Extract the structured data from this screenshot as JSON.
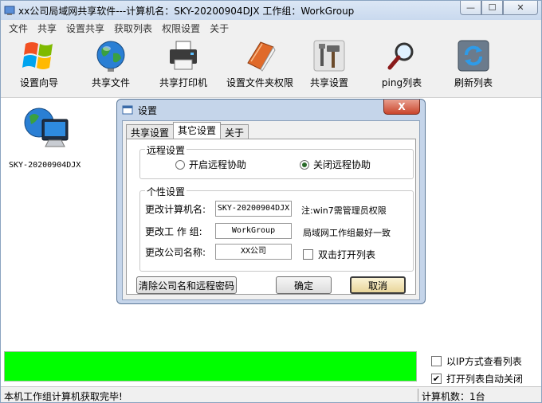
{
  "window": {
    "title": "xx公司局域网共享软件---计算机名：SKY-20200904DJX 工作组：WorkGroup",
    "minimize_glyph": "—",
    "maximize_glyph": "☐",
    "close_glyph": "✕"
  },
  "menu": [
    "文件",
    "共享",
    "设置共享",
    "获取列表",
    "权限设置",
    "关于"
  ],
  "toolbar": [
    {
      "label": "设置向导",
      "icon": "windows-logo-icon"
    },
    {
      "label": "共享文件",
      "icon": "globe-icon"
    },
    {
      "label": "共享打印机",
      "icon": "printer-icon"
    },
    {
      "label": "设置文件夹权限",
      "icon": "book-icon"
    },
    {
      "label": "共享设置",
      "icon": "tools-icon"
    },
    {
      "label": "ping列表",
      "icon": "magnifier-icon"
    },
    {
      "label": "刷新列表",
      "icon": "refresh-icon"
    }
  ],
  "computers": [
    {
      "name": "SKY-20200904DJX",
      "icon": "networked-computer-icon"
    }
  ],
  "dialog": {
    "title": "设置",
    "close_glyph": "X",
    "tabs": [
      "共享设置",
      "其它设置",
      "关于"
    ],
    "active_tab": "其它设置",
    "remote": {
      "group_title": "远程设置",
      "options": [
        {
          "label": "开启远程协助",
          "selected": false
        },
        {
          "label": "关闭远程协助",
          "selected": true
        }
      ]
    },
    "personal": {
      "group_title": "个性设置",
      "computer_name_label": "更改计算机名:",
      "computer_name_value": "SKY-20200904DJX",
      "computer_name_note": "注:win7需管理员权限",
      "workgroup_label": "更改工 作 组:",
      "workgroup_value": "WorkGroup",
      "workgroup_note": "局域网工作组最好一致",
      "company_label": "更改公司名称:",
      "company_value": "XX公司",
      "dblclick_label": "双击打开列表",
      "dblclick_checked": false
    },
    "buttons": {
      "clear": "清除公司名和远程密码",
      "ok": "确定",
      "cancel": "取消"
    }
  },
  "progress": {
    "value": 1.0,
    "color": "#00ff00"
  },
  "options": [
    {
      "label": "以IP方式查看列表",
      "checked": false
    },
    {
      "label": "打开列表自动关闭",
      "checked": true
    }
  ],
  "status": {
    "left": "本机工作组计算机获取完毕!",
    "right": "计算机数：1台"
  }
}
